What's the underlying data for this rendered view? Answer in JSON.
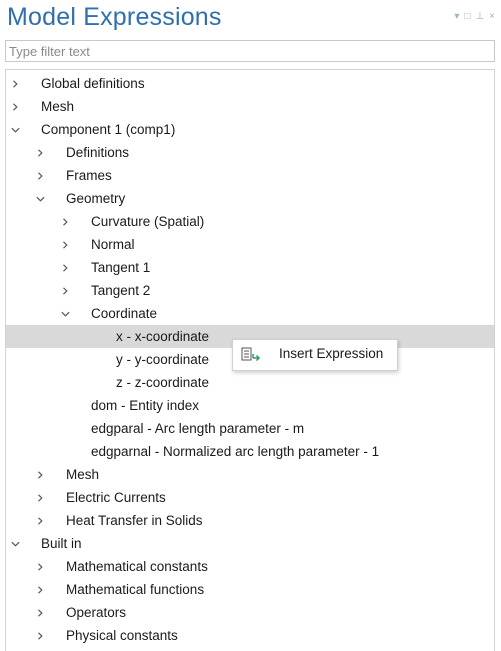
{
  "panel": {
    "title": "Model Expressions",
    "controls": {
      "menu": "▾",
      "maximize": "□",
      "pin": "⊥",
      "close": "×"
    }
  },
  "filter": {
    "placeholder": "Type filter text",
    "value": ""
  },
  "tree": [
    {
      "label": "Global definitions",
      "level": 0,
      "chevron": "collapsed"
    },
    {
      "label": "Mesh",
      "level": 0,
      "chevron": "collapsed"
    },
    {
      "label": "Component 1 (comp1)",
      "level": 0,
      "chevron": "expanded"
    },
    {
      "label": "Definitions",
      "level": 1,
      "chevron": "collapsed"
    },
    {
      "label": "Frames",
      "level": 1,
      "chevron": "collapsed"
    },
    {
      "label": "Geometry",
      "level": 1,
      "chevron": "expanded"
    },
    {
      "label": "Curvature (Spatial)",
      "level": 2,
      "chevron": "collapsed"
    },
    {
      "label": "Normal",
      "level": 2,
      "chevron": "collapsed"
    },
    {
      "label": "Tangent 1",
      "level": 2,
      "chevron": "collapsed"
    },
    {
      "label": "Tangent 2",
      "level": 2,
      "chevron": "collapsed"
    },
    {
      "label": "Coordinate",
      "level": 2,
      "chevron": "expanded"
    },
    {
      "label": "x - x-coordinate",
      "level": 3,
      "chevron": "none",
      "selected": true
    },
    {
      "label": "y - y-coordinate",
      "level": 3,
      "chevron": "none"
    },
    {
      "label": "z - z-coordinate",
      "level": 3,
      "chevron": "none"
    },
    {
      "label": "dom - Entity index",
      "level": 2,
      "chevron": "none"
    },
    {
      "label": "edgparal - Arc length parameter - m",
      "level": 2,
      "chevron": "none"
    },
    {
      "label": "edgparnal - Normalized arc length parameter - 1",
      "level": 2,
      "chevron": "none"
    },
    {
      "label": "Mesh",
      "level": 1,
      "chevron": "collapsed"
    },
    {
      "label": "Electric Currents",
      "level": 1,
      "chevron": "collapsed"
    },
    {
      "label": "Heat Transfer in Solids",
      "level": 1,
      "chevron": "collapsed"
    },
    {
      "label": "Built in",
      "level": 0,
      "chevron": "expanded"
    },
    {
      "label": "Mathematical constants",
      "level": 1,
      "chevron": "collapsed"
    },
    {
      "label": "Mathematical functions",
      "level": 1,
      "chevron": "collapsed"
    },
    {
      "label": "Operators",
      "level": 1,
      "chevron": "collapsed"
    },
    {
      "label": "Physical constants",
      "level": 1,
      "chevron": "collapsed"
    }
  ],
  "context_menu": {
    "items": [
      {
        "label": "Insert Expression",
        "icon": "insert-expression-icon"
      }
    ]
  },
  "colors": {
    "title": "#2f6fb0",
    "selection": "#d9d9d9",
    "controls": "#9ab4d2"
  }
}
